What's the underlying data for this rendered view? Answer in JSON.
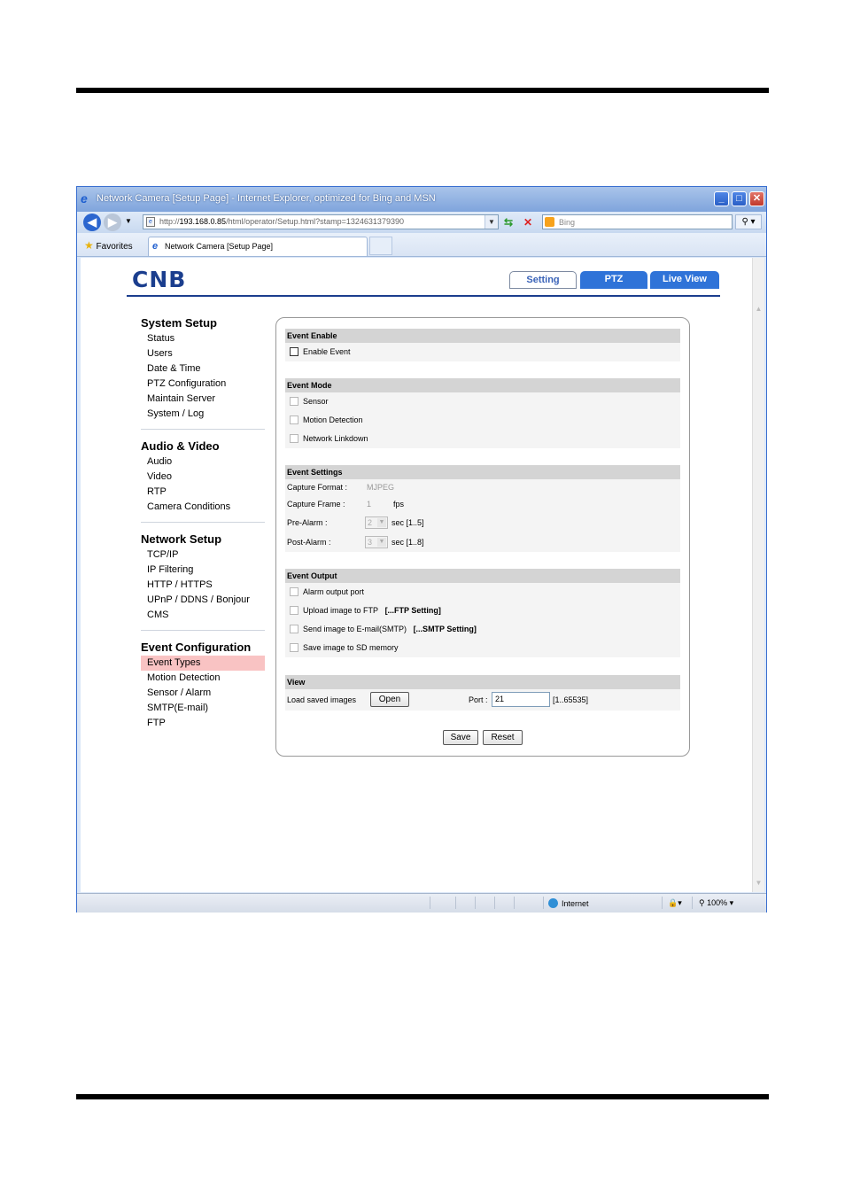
{
  "browser": {
    "window_title": "Network Camera [Setup Page] - Internet Explorer, optimized for Bing and MSN",
    "url_prefix": "http://",
    "url_host": "193.168.0.85",
    "url_path": "/html/operator/Setup.html?stamp=1324631379390",
    "search_placeholder": "Bing",
    "favorites_label": "Favorites",
    "tab_title": "Network Camera [Setup Page]",
    "status_zone": "Internet",
    "status_zoom": "100%"
  },
  "header": {
    "logo": "CNB",
    "tabs": [
      "Setting",
      "PTZ",
      "Live View"
    ]
  },
  "sidebar": {
    "groups": [
      {
        "title": "System Setup",
        "items": [
          "Status",
          "Users",
          "Date & Time",
          "PTZ Configuration",
          "Maintain Server",
          "System / Log"
        ]
      },
      {
        "title": "Audio & Video",
        "items": [
          "Audio",
          "Video",
          "RTP",
          "Camera Conditions"
        ]
      },
      {
        "title": "Network Setup",
        "items": [
          "TCP/IP",
          "IP Filtering",
          "HTTP / HTTPS",
          "UPnP / DDNS / Bonjour",
          "CMS"
        ]
      },
      {
        "title": "Event Configuration",
        "items": [
          "Event Types",
          "Motion Detection",
          "Sensor / Alarm",
          "SMTP(E-mail)",
          "FTP"
        ]
      }
    ],
    "selected": "Event Types"
  },
  "event_enable": {
    "header": "Event Enable",
    "enable_label": "Enable Event",
    "enabled": false
  },
  "event_mode": {
    "header": "Event Mode",
    "options": [
      "Sensor",
      "Motion Detection",
      "Network Linkdown"
    ]
  },
  "event_settings": {
    "header": "Event Settings",
    "capture_format_label": "Capture Format :",
    "capture_format_value": "MJPEG",
    "capture_frame_label": "Capture Frame :",
    "capture_frame_value": "1",
    "capture_frame_unit": "fps",
    "pre_alarm_label": "Pre-Alarm :",
    "pre_alarm_value": "2",
    "pre_alarm_unit": "sec [1..5]",
    "post_alarm_label": "Post-Alarm :",
    "post_alarm_value": "3",
    "post_alarm_unit": "sec [1..8]"
  },
  "event_output": {
    "header": "Event Output",
    "alarm_output": "Alarm output port",
    "upload_ftp": "Upload image to FTP",
    "ftp_link": "[...FTP Setting]",
    "send_email": "Send image to E-mail(SMTP)",
    "smtp_link": "[...SMTP Setting]",
    "save_sd": "Save image to SD memory"
  },
  "view": {
    "header": "View",
    "load_label": "Load saved images",
    "open_button": "Open",
    "port_label": "Port :",
    "port_value": "21",
    "port_range": "[1..65535]"
  },
  "actions": {
    "save": "Save",
    "reset": "Reset"
  }
}
